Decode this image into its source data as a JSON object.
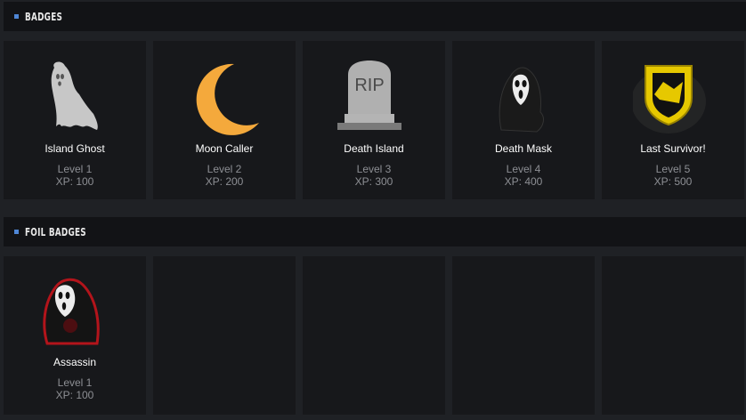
{
  "badges_section": {
    "title": "BADGES",
    "items": [
      {
        "name": "Island Ghost",
        "level": "Level 1",
        "xp": "XP: 100",
        "icon": "ghost-icon"
      },
      {
        "name": "Moon Caller",
        "level": "Level 2",
        "xp": "XP: 200",
        "icon": "moon-icon"
      },
      {
        "name": "Death Island",
        "level": "Level 3",
        "xp": "XP: 300",
        "icon": "tombstone-icon"
      },
      {
        "name": "Death Mask",
        "level": "Level 4",
        "xp": "XP: 400",
        "icon": "death-mask-icon"
      },
      {
        "name": "Last Survivor!",
        "level": "Level 5",
        "xp": "XP: 500",
        "icon": "shield-icon"
      }
    ]
  },
  "foil_badges_section": {
    "title": "FOIL BADGES",
    "items": [
      {
        "name": "Assassin",
        "level": "Level 1",
        "xp": "XP: 100",
        "icon": "assassin-icon"
      }
    ]
  },
  "tombstone_text": "RIP",
  "colors": {
    "accent": "#4f87d6",
    "moon": "#f4a93c",
    "shield": "#e6c800",
    "assassin_trim": "#b3141b"
  }
}
